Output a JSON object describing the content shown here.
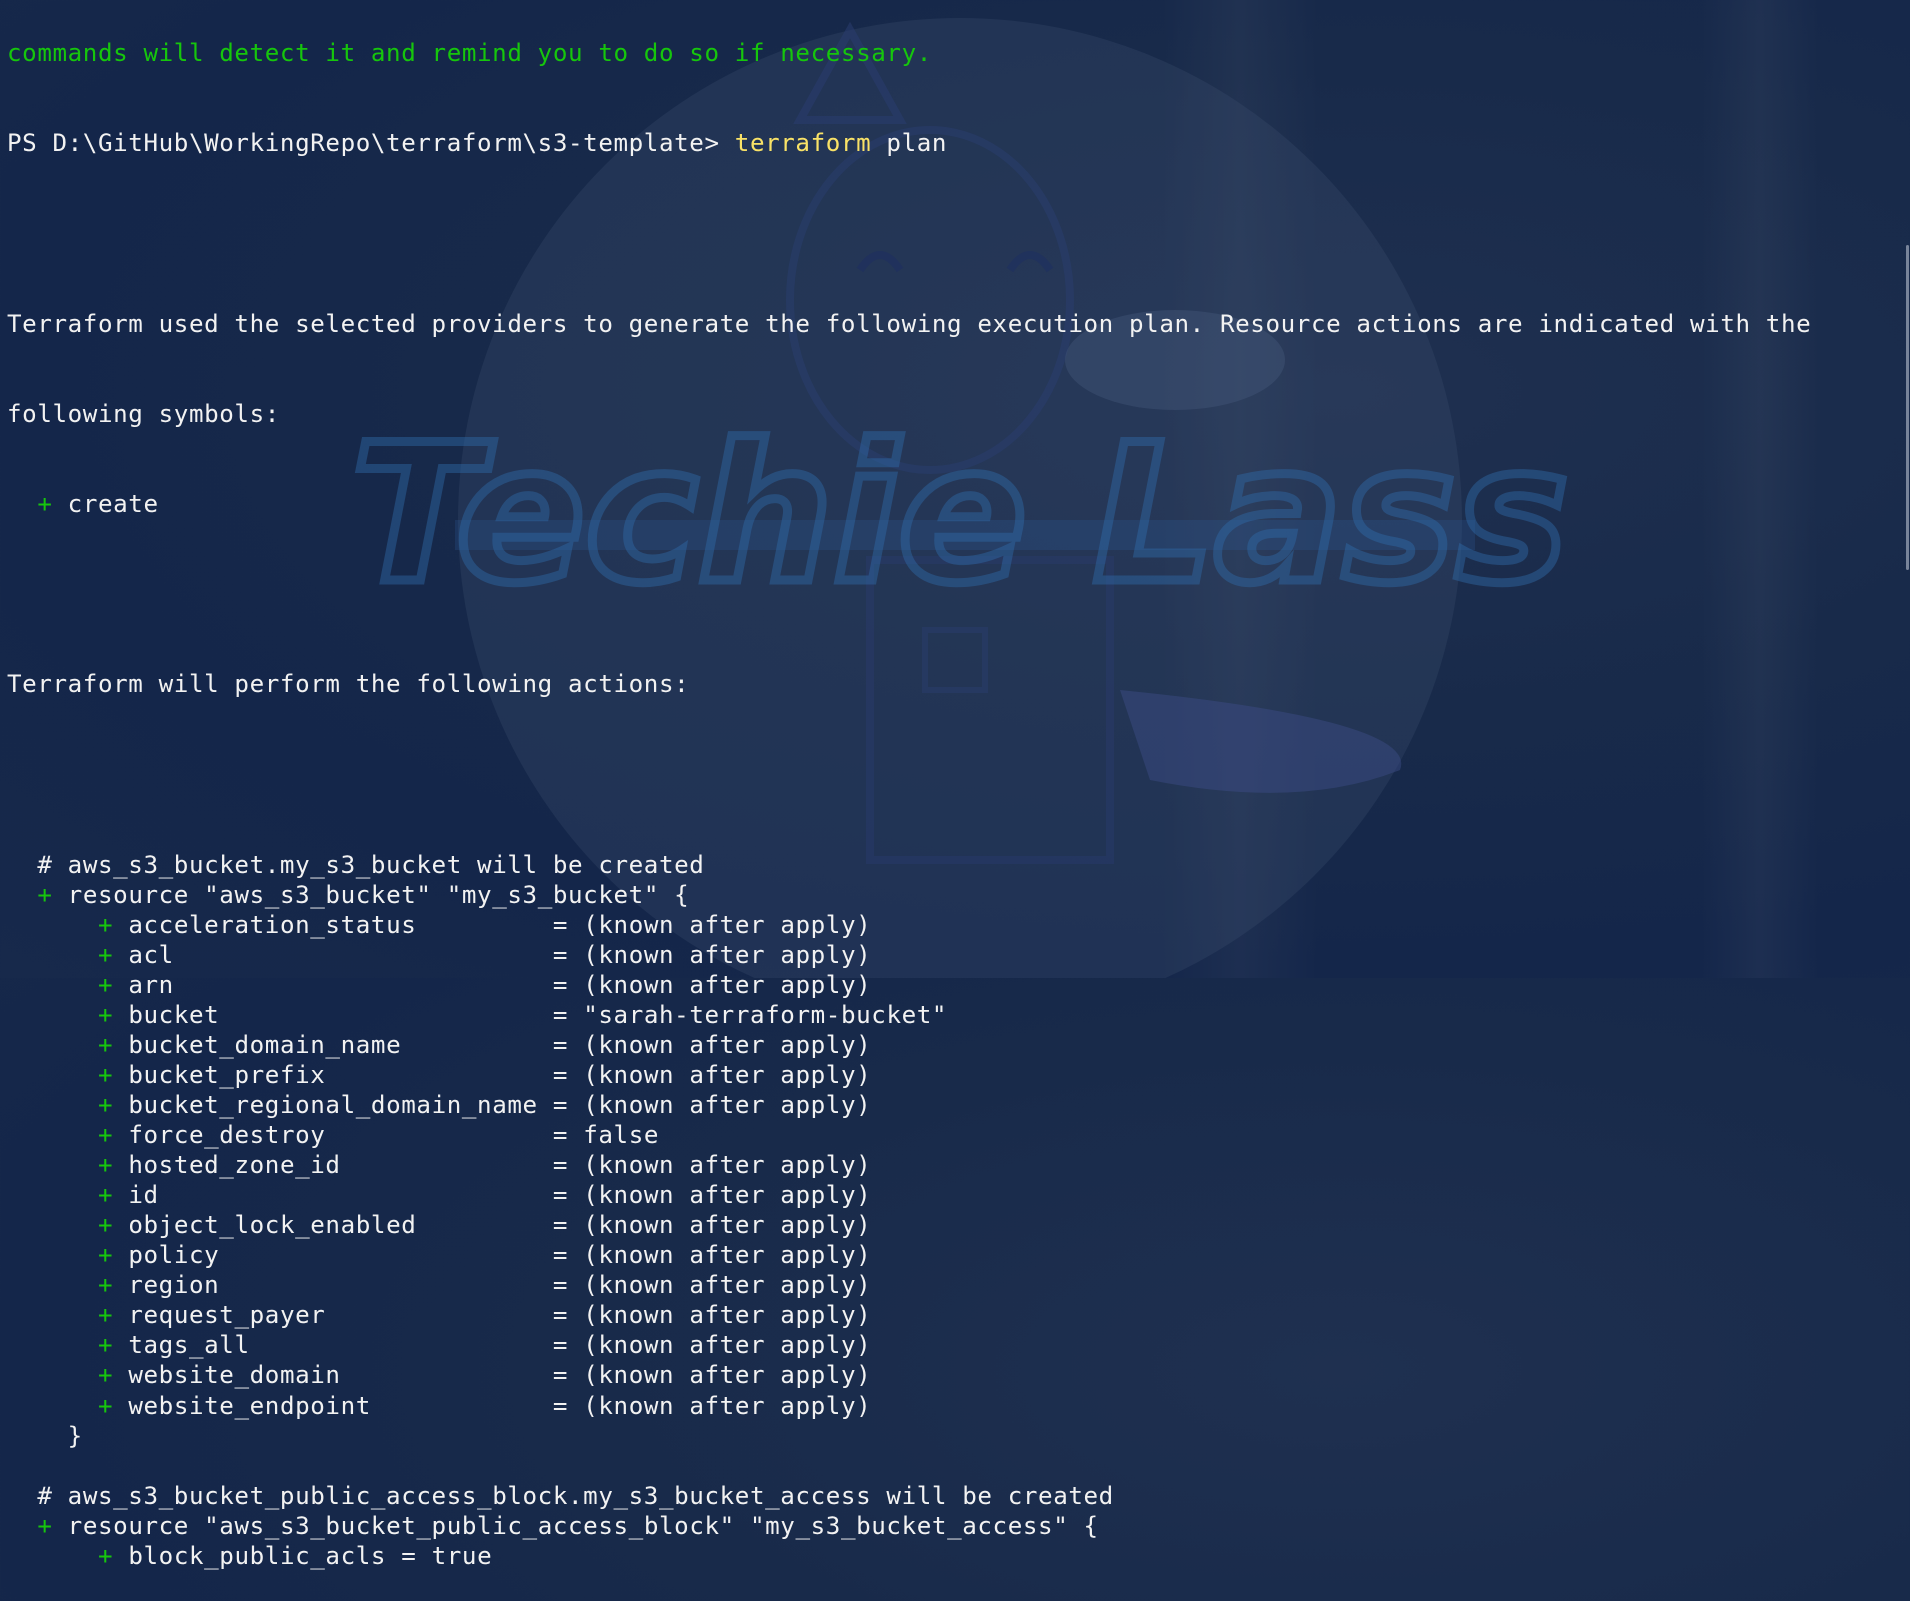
{
  "window": {
    "type": "terminal",
    "shell": "PowerShell"
  },
  "colors": {
    "text": "#f2f2f2",
    "green": "#16c60c",
    "command": "#f9e267",
    "background": "#172a4b"
  },
  "watermark": {
    "text": "Techie Lass",
    "icon": "unicorn-logo-icon"
  },
  "terminal": {
    "previous_output": "commands will detect it and remind you to do so if necessary.",
    "prompt": "PS D:\\GitHub\\WorkingRepo\\terraform\\s3-template> ",
    "command": "terraform",
    "command_args": " plan",
    "intro_line1": "Terraform used the selected providers to generate the following execution plan. Resource actions are indicated with the",
    "intro_line2": "following symbols:",
    "symbol_plus": "+",
    "symbol_create": " create",
    "actions_header": "Terraform will perform the following actions:",
    "resources": [
      {
        "comment": "# aws_s3_bucket.my_s3_bucket will be created",
        "declaration": "resource \"aws_s3_bucket\" \"my_s3_bucket\" {",
        "attributes": [
          {
            "name": "acceleration_status",
            "value": "(known after apply)"
          },
          {
            "name": "acl",
            "value": "(known after apply)"
          },
          {
            "name": "arn",
            "value": "(known after apply)"
          },
          {
            "name": "bucket",
            "value": "\"sarah-terraform-bucket\""
          },
          {
            "name": "bucket_domain_name",
            "value": "(known after apply)"
          },
          {
            "name": "bucket_prefix",
            "value": "(known after apply)"
          },
          {
            "name": "bucket_regional_domain_name",
            "value": "(known after apply)"
          },
          {
            "name": "force_destroy",
            "value": "false"
          },
          {
            "name": "hosted_zone_id",
            "value": "(known after apply)"
          },
          {
            "name": "id",
            "value": "(known after apply)"
          },
          {
            "name": "object_lock_enabled",
            "value": "(known after apply)"
          },
          {
            "name": "policy",
            "value": "(known after apply)"
          },
          {
            "name": "region",
            "value": "(known after apply)"
          },
          {
            "name": "request_payer",
            "value": "(known after apply)"
          },
          {
            "name": "tags_all",
            "value": "(known after apply)"
          },
          {
            "name": "website_domain",
            "value": "(known after apply)"
          },
          {
            "name": "website_endpoint",
            "value": "(known after apply)"
          }
        ],
        "closing": "}"
      },
      {
        "comment": "# aws_s3_bucket_public_access_block.my_s3_bucket_access will be created",
        "declaration": "resource \"aws_s3_bucket_public_access_block\" \"my_s3_bucket_access\" {",
        "attributes": [
          {
            "name": "block_public_acls",
            "value": "true"
          }
        ]
      }
    ]
  }
}
